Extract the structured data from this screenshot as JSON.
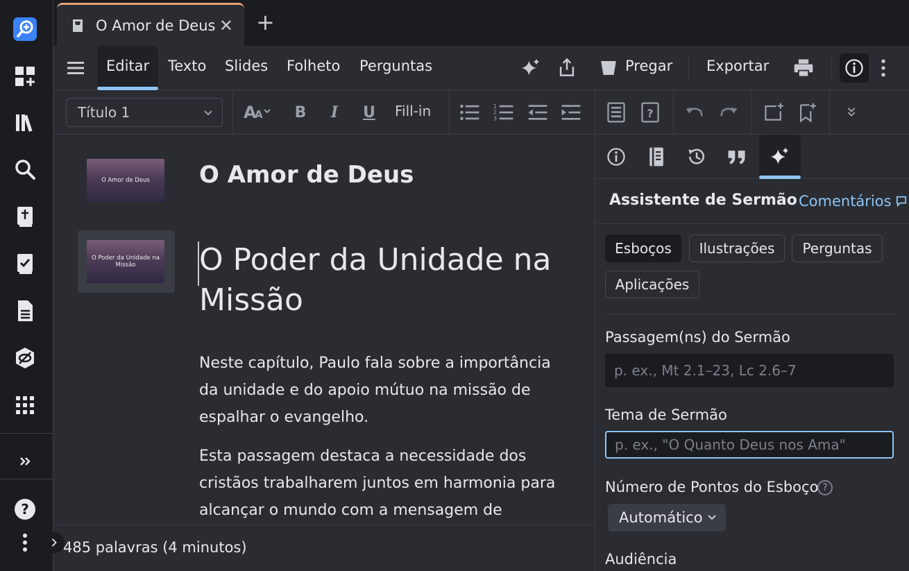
{
  "tab": {
    "title": "O Amor de Deus",
    "close_glyph": "✕",
    "add_glyph": "+"
  },
  "menu": {
    "items": [
      "Editar",
      "Texto",
      "Slides",
      "Folheto",
      "Perguntas"
    ],
    "pregar": "Pregar",
    "exportar": "Exportar"
  },
  "toolbar": {
    "style_value": "Título 1",
    "bold": "B",
    "italic": "I",
    "underline": "U",
    "fill_in": "Fill-in"
  },
  "editor": {
    "slides": [
      {
        "thumb_text": "O Amor de Deus"
      },
      {
        "thumb_text": "O Poder da Unidade na Missão"
      }
    ],
    "title": "O Amor de Deus",
    "heading": "O Poder da Unidade na Missão",
    "paragraphs": [
      "Neste capítulo, Paulo fala sobre a importância da unidade e do apoio mútuo na missão de espalhar o evangelho.",
      "Esta passagem destaca a necessidade dos cristãos trabalharem juntos em harmonia para alcançar o mundo com a mensagem de"
    ]
  },
  "status": {
    "word_count": "485 palavras (4 minutos)"
  },
  "panel": {
    "title": "Assistente de Sermão",
    "link": "Comentários",
    "chips": [
      "Esboços",
      "Ilustrações",
      "Perguntas",
      "Aplicações"
    ],
    "passage_label": "Passagem(ns) do Sermão",
    "passage_placeholder": "p. ex., Mt 2.1–23, Lc 2.6–7",
    "theme_label": "Tema de Sermão",
    "theme_placeholder": "p. ex., \"O Quanto Deus nos Ama\"",
    "points_label": "Número de Pontos do Esboço",
    "points_value": "Automático",
    "audience_label": "Audiência",
    "help_glyph": "?"
  },
  "colors": {
    "accent": "#8ec5f5",
    "tab_top": "#e8a07a",
    "brand": "#3b82f6"
  }
}
